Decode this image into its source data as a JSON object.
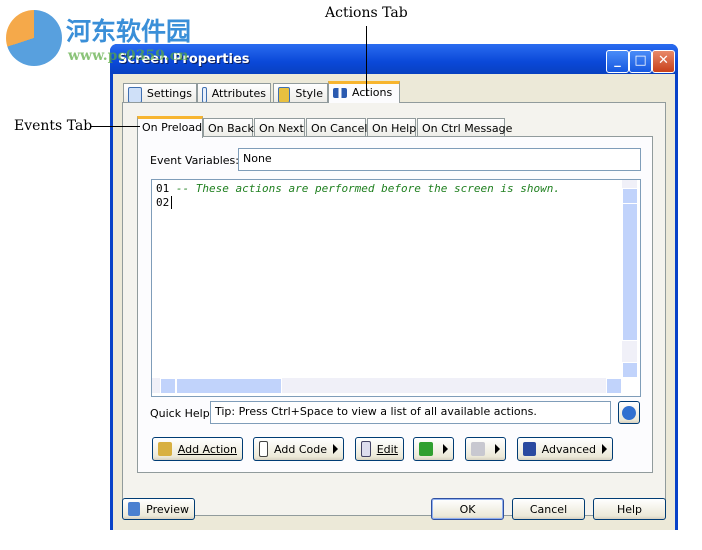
{
  "watermark": {
    "logo_text": "河东软件园",
    "url": "www.pc0359.cn"
  },
  "annotations": {
    "actions_tab": "Actions Tab",
    "events_tab": "Events Tab"
  },
  "window": {
    "title": "Screen Properties",
    "minimize": "_",
    "maximize": "□",
    "close": "✕"
  },
  "main_tabs": [
    {
      "label": "Settings",
      "icon": "pencil-icon"
    },
    {
      "label": "Attributes",
      "icon": "window-icon"
    },
    {
      "label": "Style",
      "icon": "paint-icon"
    },
    {
      "label": "Actions",
      "icon": "flow-icon",
      "selected": true
    }
  ],
  "event_tabs": [
    {
      "label": "On Preload",
      "selected": true
    },
    {
      "label": "On Back"
    },
    {
      "label": "On Next"
    },
    {
      "label": "On Cancel"
    },
    {
      "label": "On Help"
    },
    {
      "label": "On Ctrl Message"
    }
  ],
  "event_variables": {
    "label": "Event Variables:",
    "value": "None"
  },
  "editor": {
    "lines": [
      {
        "num": "01",
        "text": "-- These actions are performed before the screen is shown."
      },
      {
        "num": "02",
        "text": ""
      }
    ]
  },
  "quick_help": {
    "label": "Quick Help:",
    "value": "Tip: Press Ctrl+Space to view a list of all available actions."
  },
  "buttons": {
    "add_action": "Add Action",
    "add_code": "Add Code",
    "edit": "Edit",
    "advanced": "Advanced"
  },
  "footer": {
    "preview": "Preview",
    "ok": "OK",
    "cancel": "Cancel",
    "help": "Help"
  }
}
